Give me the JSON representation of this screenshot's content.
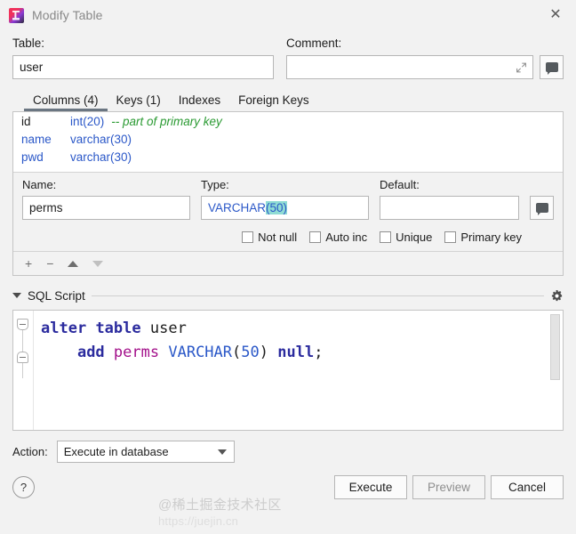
{
  "window": {
    "title": "Modify Table",
    "logo_icon": "intellij-idea-logo",
    "close_icon": "close-icon"
  },
  "form": {
    "table_label": "Table:",
    "table_value": "user",
    "table_placeholder": "",
    "comment_label": "Comment:",
    "comment_value": "",
    "comment_placeholder": "",
    "expand_icon": "expand-arrows-icon",
    "comment_button_icon": "comment-bubble-icon"
  },
  "tabs": [
    {
      "label": "Columns (4)",
      "active": true
    },
    {
      "label": "Keys (1)",
      "active": false
    },
    {
      "label": "Indexes",
      "active": false
    },
    {
      "label": "Foreign Keys",
      "active": false
    }
  ],
  "columns": [
    {
      "name": "id",
      "type": "int(20)",
      "comment": "-- part of primary key",
      "primary": true
    },
    {
      "name": "name",
      "type": "varchar(30)",
      "comment": "",
      "primary": false
    },
    {
      "name": "pwd",
      "type": "varchar(30)",
      "comment": "",
      "primary": false
    }
  ],
  "editor": {
    "name_label": "Name:",
    "name_value": "perms",
    "type_label": "Type:",
    "type_value_prefix": "VARCHAR",
    "type_value_selected": "(50)",
    "default_label": "Default:",
    "default_value": "",
    "default_button_icon": "comment-bubble-icon",
    "checkboxes": [
      {
        "label": "Not null",
        "checked": false
      },
      {
        "label": "Auto inc",
        "checked": false
      },
      {
        "label": "Unique",
        "checked": false
      },
      {
        "label": "Primary key",
        "checked": false
      }
    ]
  },
  "list_toolbar": [
    {
      "icon": "plus-icon",
      "label": "+",
      "enabled": true
    },
    {
      "icon": "minus-icon",
      "label": "−",
      "enabled": true
    },
    {
      "icon": "arrow-up-icon",
      "label": "",
      "enabled": true
    },
    {
      "icon": "arrow-down-icon",
      "label": "",
      "enabled": false
    }
  ],
  "sql_section": {
    "collapse_icon": "caret-down-icon",
    "title": "SQL Script",
    "settings_icon": "gear-icon",
    "line1": {
      "kw1": "alter",
      "kw2": "table",
      "ident": "user"
    },
    "line2": {
      "kw1": "add",
      "ident": "perms",
      "type": "VARCHAR",
      "open_paren": "(",
      "size": "50",
      "close_paren": ")",
      "kw2": "null",
      "semi": ";"
    }
  },
  "footer": {
    "action_label": "Action:",
    "action_value": "Execute in database",
    "action_caret_icon": "caret-down-icon",
    "help_label": "?",
    "execute_label": "Execute",
    "preview_label": "Preview",
    "cancel_label": "Cancel"
  },
  "watermark": {
    "text": "@稀土掘金技术社区",
    "url": "https://juejin.cn"
  },
  "colors": {
    "accent": "#2b58c8",
    "comment_green": "#2a9a32",
    "selection_teal": "#8fdcd4",
    "keyword_blue": "#2b2b9e",
    "identifier_pink": "#a3108a",
    "tab_underline": "#6b7682"
  }
}
